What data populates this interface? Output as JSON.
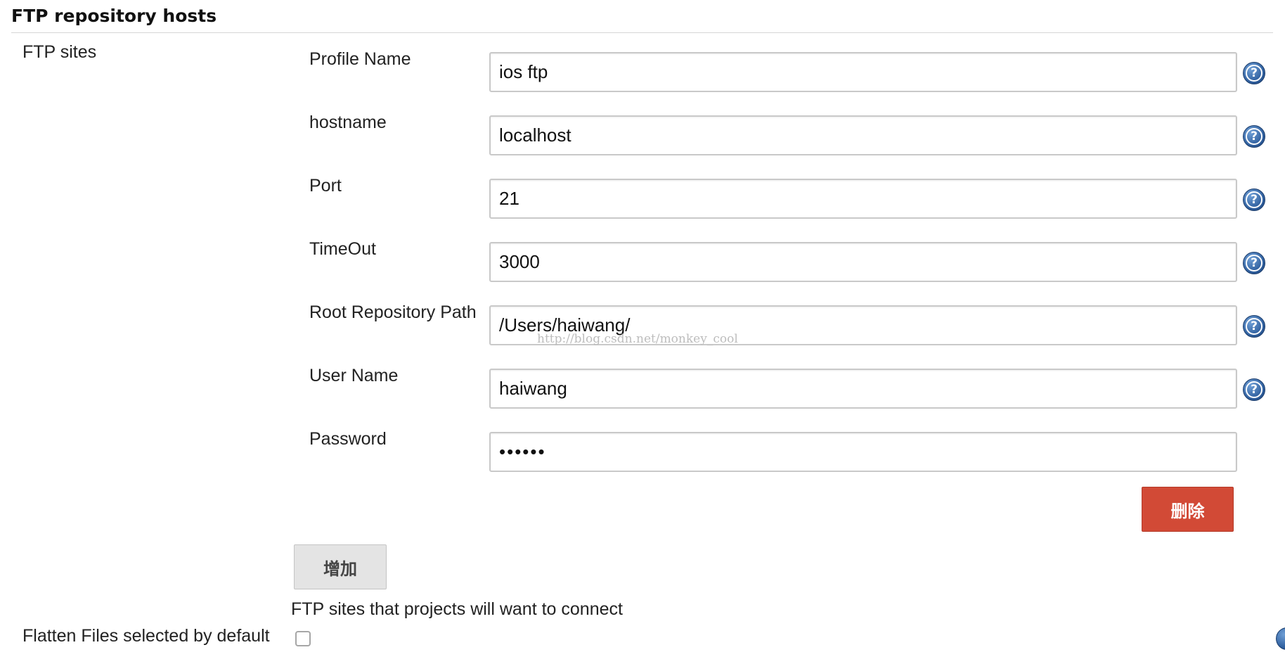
{
  "header": {
    "title": "FTP repository hosts"
  },
  "ftp_sites": {
    "label": "FTP sites",
    "fields": [
      {
        "label": "Profile Name",
        "value": "ios ftp",
        "has_help": true
      },
      {
        "label": "hostname",
        "value": "localhost",
        "has_help": true
      },
      {
        "label": "Port",
        "value": "21",
        "has_help": true
      },
      {
        "label": "TimeOut",
        "value": "3000",
        "has_help": true
      },
      {
        "label": "Root Repository Path",
        "value": "/Users/haiwang/",
        "has_help": true
      },
      {
        "label": "User Name",
        "value": "haiwang",
        "has_help": true
      },
      {
        "label": "Password",
        "value": "••••••",
        "has_help": false
      }
    ],
    "delete_label": "删除",
    "add_label": "增加",
    "description": "FTP sites that projects will want to connect"
  },
  "watermark": "http://blog.csdn.net/monkey_cool",
  "flatten": {
    "label": "Flatten Files selected by default",
    "checked": false
  },
  "colors": {
    "delete_button": "#d24a36",
    "add_button": "#e4e4e4",
    "help_icon": "#2e5e9d",
    "input_border": "#c9c9c9"
  },
  "icons": {
    "help": "help-icon"
  }
}
